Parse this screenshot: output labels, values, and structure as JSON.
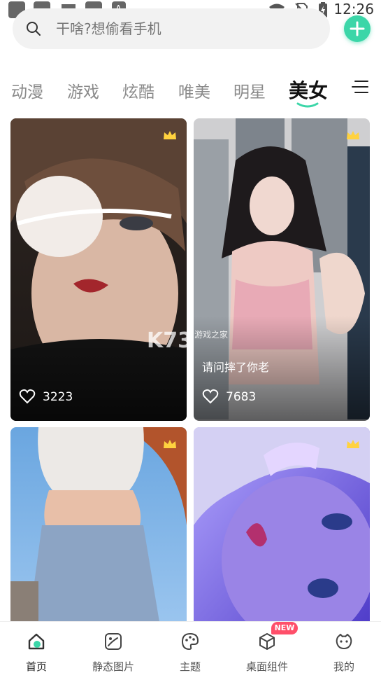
{
  "status_bar": {
    "time": "12:26",
    "left_icons": [
      "app-icon",
      "app-icon",
      "app-icon",
      "app-icon",
      "a-icon"
    ],
    "right_icons": [
      "wifi-icon",
      "no-sim-icon",
      "battery-charging-icon"
    ]
  },
  "search": {
    "placeholder": "干啥?想偷看手机"
  },
  "colors": {
    "accent": "#3bd6a8",
    "badge": "#ff4f6a",
    "tab_inactive": "#8a8a8a"
  },
  "tabs": [
    {
      "label": "动漫",
      "active": false
    },
    {
      "label": "游戏",
      "active": false
    },
    {
      "label": "炫酷",
      "active": false
    },
    {
      "label": "唯美",
      "active": false
    },
    {
      "label": "明星",
      "active": false
    },
    {
      "label": "美女",
      "active": true
    }
  ],
  "cards": [
    {
      "likes": "3223",
      "caption": ""
    },
    {
      "likes": "7683",
      "caption": "请问摔了你老"
    },
    {
      "likes": "",
      "caption": ""
    },
    {
      "likes": "",
      "caption": ""
    }
  ],
  "watermark": {
    "text": "K73",
    "sub": "游戏之家"
  },
  "bottom_nav": [
    {
      "label": "首页",
      "icon": "home-icon",
      "active": true
    },
    {
      "label": "静态图片",
      "icon": "image-icon",
      "active": false
    },
    {
      "label": "主题",
      "icon": "palette-icon",
      "active": false
    },
    {
      "label": "桌面组件",
      "icon": "cube-icon",
      "active": false,
      "badge": "NEW"
    },
    {
      "label": "我的",
      "icon": "profile-icon",
      "active": false
    }
  ]
}
